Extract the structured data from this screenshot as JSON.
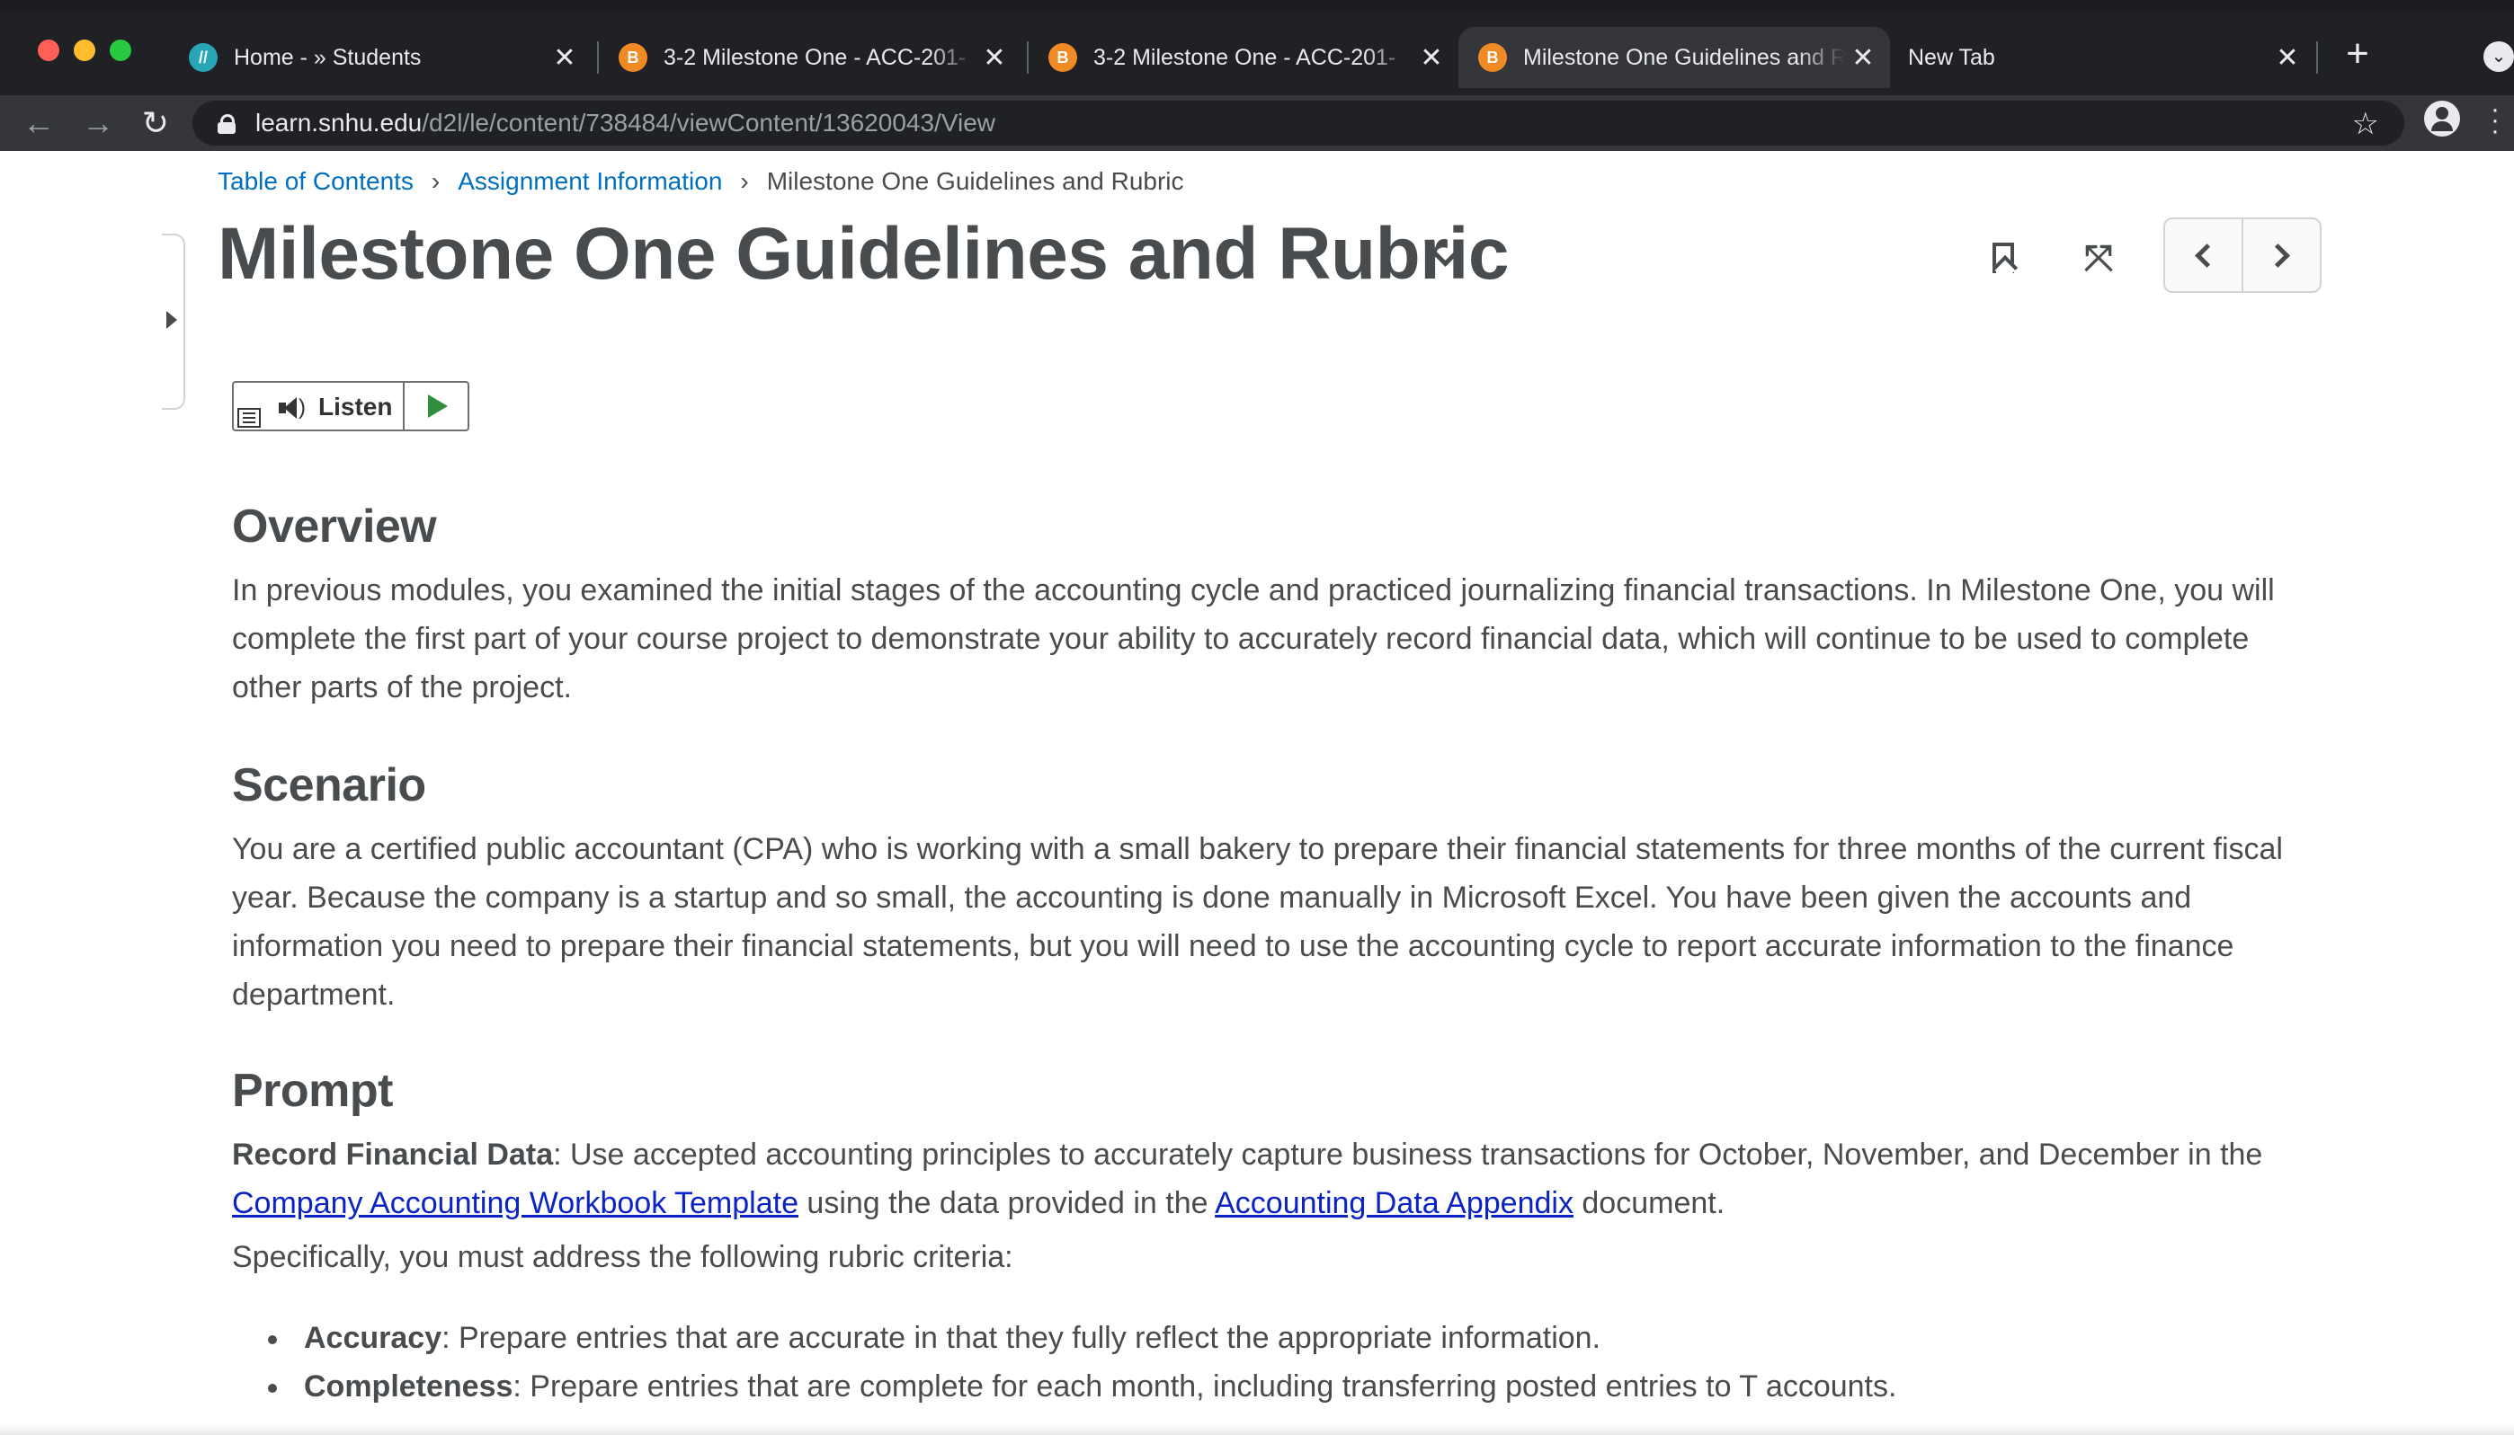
{
  "browser": {
    "tabs": [
      {
        "title": "Home - » Students",
        "favicon": "snhu-icon",
        "active": false
      },
      {
        "title": "3-2 Milestone One - ACC-201-",
        "favicon": "brightspace-icon",
        "active": false
      },
      {
        "title": "3-2 Milestone One - ACC-201-",
        "favicon": "brightspace-icon",
        "active": false
      },
      {
        "title": "Milestone One Guidelines and R",
        "favicon": "brightspace-icon",
        "active": true
      },
      {
        "title": "New Tab",
        "favicon": "",
        "active": false
      }
    ],
    "url_host": "learn.snhu.edu",
    "url_path": "/d2l/le/content/738484/viewContent/13620043/View",
    "favicon_letter": "B",
    "snhu_letter": "//",
    "close_glyph": "✕",
    "new_tab_glyph": "+"
  },
  "breadcrumb": {
    "items": [
      "Table of Contents",
      "Assignment Information"
    ],
    "current": "Milestone One Guidelines and Rubric",
    "separator": "›"
  },
  "page": {
    "title": "Milestone One Guidelines and Rubric"
  },
  "listen": {
    "label": "Listen"
  },
  "sections": {
    "overview": {
      "heading": "Overview",
      "text": "In previous modules, you examined the initial stages of the accounting cycle and practiced journalizing financial transactions. In Milestone One, you will complete the first part of your course project to demonstrate your ability to accurately record financial data, which will continue to be used to complete other parts of the project."
    },
    "scenario": {
      "heading": "Scenario",
      "text": "You are a certified public accountant (CPA) who is working with a small bakery to prepare their financial statements for three months of the current fiscal year. Because the company is a startup and so small, the accounting is done manually in Microsoft Excel. You have been given the accounts and information you need to prepare their financial statements, but you will need to use the accounting cycle to report accurate information to the finance department."
    },
    "prompt": {
      "heading": "Prompt",
      "lead_bold": "Record Financial Data",
      "lead_text_1": ": Use accepted accounting principles to accurately capture business transactions for October, November, and December in the ",
      "link_1": "Company Accounting Workbook Template",
      "lead_text_2": " using the data provided in the ",
      "link_2": "Accounting Data Appendix",
      "lead_text_3": " document.",
      "criteria_intro": "Specifically, you must address the following rubric criteria:",
      "criteria": [
        {
          "term": "Accuracy",
          "text": ": Prepare entries that are accurate in that they fully reflect the appropriate information."
        },
        {
          "term": "Completeness",
          "text": ": Prepare entries that are complete for each month, including transferring posted entries to T accounts."
        }
      ]
    }
  },
  "colors": {
    "link": "#006fbf",
    "body_link": "#0b23c4",
    "text": "#494c4e",
    "play": "#2f8f3f"
  }
}
